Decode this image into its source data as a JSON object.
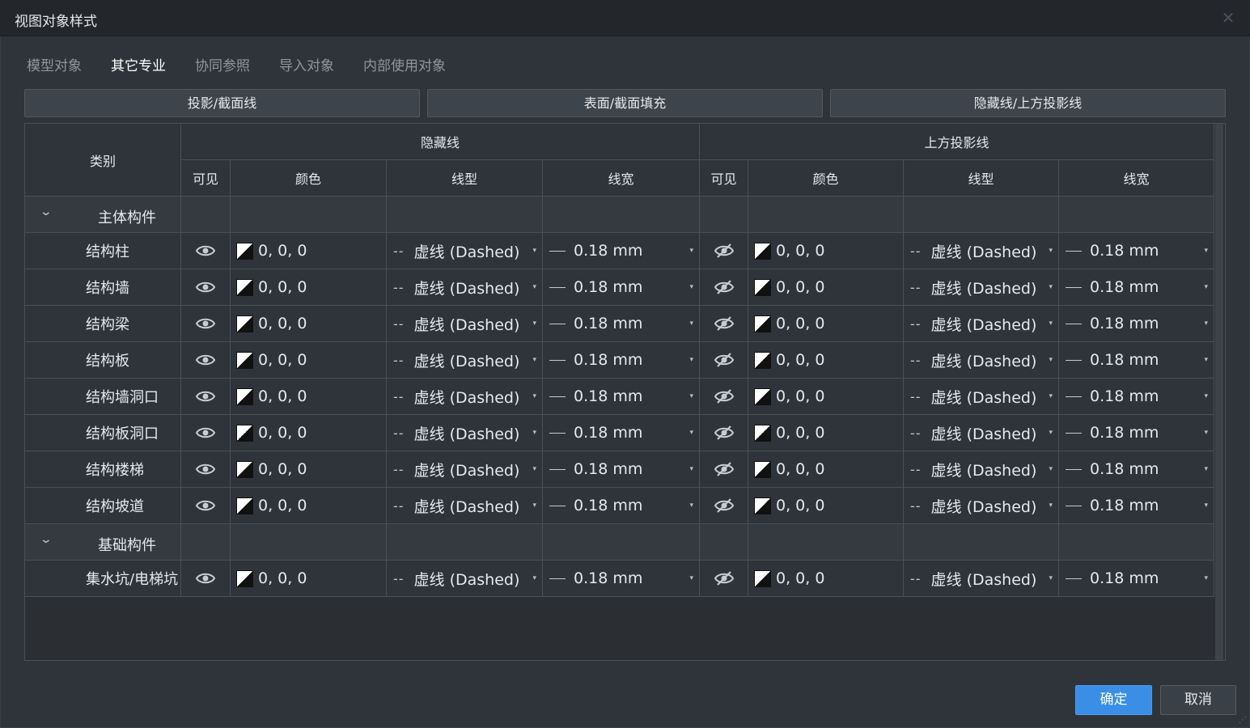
{
  "window": {
    "title": "视图对象样式"
  },
  "tabs": [
    {
      "label": "模型对象",
      "active": false
    },
    {
      "label": "其它专业",
      "active": true
    },
    {
      "label": "协同参照",
      "active": false
    },
    {
      "label": "导入对象",
      "active": false
    },
    {
      "label": "内部使用对象",
      "active": false
    }
  ],
  "subtabs": [
    {
      "label": "投影/截面线"
    },
    {
      "label": "表面/截面填充"
    },
    {
      "label": "隐藏线/上方投影线"
    }
  ],
  "table": {
    "category_header": "类别",
    "group_headers": [
      "隐藏线",
      "上方投影线"
    ],
    "sub_headers": [
      "可见",
      "颜色",
      "线型",
      "线宽",
      "可见",
      "颜色",
      "线型",
      "线宽"
    ],
    "groups": [
      {
        "name": "主体构件",
        "rows": [
          {
            "name": "结构柱",
            "hidden": {
              "visible": true,
              "color": "0, 0, 0",
              "linetype": "虚线 (Dashed)",
              "lineweight": "0.18 mm"
            },
            "above": {
              "visible": false,
              "color": "0, 0, 0",
              "linetype": "虚线 (Dashed)",
              "lineweight": "0.18 mm"
            }
          },
          {
            "name": "结构墙",
            "hidden": {
              "visible": true,
              "color": "0, 0, 0",
              "linetype": "虚线 (Dashed)",
              "lineweight": "0.18 mm"
            },
            "above": {
              "visible": false,
              "color": "0, 0, 0",
              "linetype": "虚线 (Dashed)",
              "lineweight": "0.18 mm"
            }
          },
          {
            "name": "结构梁",
            "hidden": {
              "visible": true,
              "color": "0, 0, 0",
              "linetype": "虚线 (Dashed)",
              "lineweight": "0.18 mm"
            },
            "above": {
              "visible": false,
              "color": "0, 0, 0",
              "linetype": "虚线 (Dashed)",
              "lineweight": "0.18 mm"
            }
          },
          {
            "name": "结构板",
            "hidden": {
              "visible": true,
              "color": "0, 0, 0",
              "linetype": "虚线 (Dashed)",
              "lineweight": "0.18 mm"
            },
            "above": {
              "visible": false,
              "color": "0, 0, 0",
              "linetype": "虚线 (Dashed)",
              "lineweight": "0.18 mm"
            }
          },
          {
            "name": "结构墙洞口",
            "hidden": {
              "visible": true,
              "color": "0, 0, 0",
              "linetype": "虚线 (Dashed)",
              "lineweight": "0.18 mm"
            },
            "above": {
              "visible": false,
              "color": "0, 0, 0",
              "linetype": "虚线 (Dashed)",
              "lineweight": "0.18 mm"
            }
          },
          {
            "name": "结构板洞口",
            "hidden": {
              "visible": true,
              "color": "0, 0, 0",
              "linetype": "虚线 (Dashed)",
              "lineweight": "0.18 mm"
            },
            "above": {
              "visible": false,
              "color": "0, 0, 0",
              "linetype": "虚线 (Dashed)",
              "lineweight": "0.18 mm"
            }
          },
          {
            "name": "结构楼梯",
            "hidden": {
              "visible": true,
              "color": "0, 0, 0",
              "linetype": "虚线 (Dashed)",
              "lineweight": "0.18 mm"
            },
            "above": {
              "visible": false,
              "color": "0, 0, 0",
              "linetype": "虚线 (Dashed)",
              "lineweight": "0.18 mm"
            }
          },
          {
            "name": "结构坡道",
            "hidden": {
              "visible": true,
              "color": "0, 0, 0",
              "linetype": "虚线 (Dashed)",
              "lineweight": "0.18 mm"
            },
            "above": {
              "visible": false,
              "color": "0, 0, 0",
              "linetype": "虚线 (Dashed)",
              "lineweight": "0.18 mm"
            }
          }
        ]
      },
      {
        "name": "基础构件",
        "rows": [
          {
            "name": "集水坑/电梯坑",
            "hidden": {
              "visible": true,
              "color": "0, 0, 0",
              "linetype": "虚线 (Dashed)",
              "lineweight": "0.18 mm"
            },
            "above": {
              "visible": false,
              "color": "0, 0, 0",
              "linetype": "虚线 (Dashed)",
              "lineweight": "0.18 mm"
            }
          }
        ]
      }
    ]
  },
  "buttons": {
    "ok": "确定",
    "cancel": "取消"
  },
  "colors": {
    "accent": "#3a8ee6",
    "background": "#2f343a",
    "titlebar": "#23272c"
  }
}
